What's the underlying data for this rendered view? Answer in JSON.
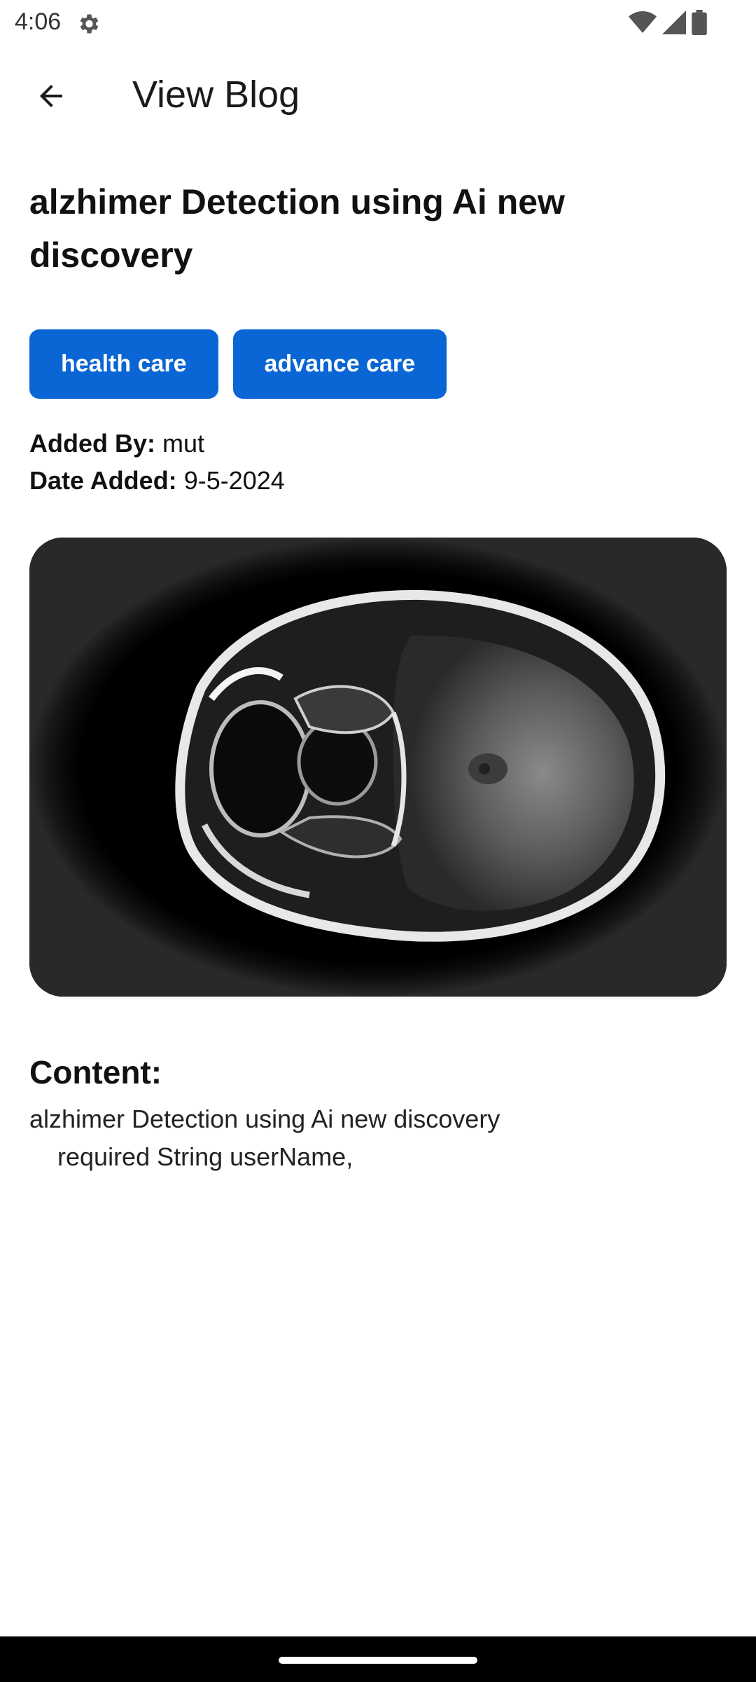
{
  "status_bar": {
    "time": "4:06",
    "icons": [
      "gear-icon",
      "wifi-icon",
      "signal-icon",
      "battery-icon"
    ]
  },
  "app_bar": {
    "title": "View Blog",
    "back_icon": "arrow-back-icon"
  },
  "blog": {
    "title": "alzhimer Detection using Ai new discovery",
    "tags": [
      "health care",
      "advance care"
    ],
    "added_by_label": "Added By:",
    "added_by_value": "mut",
    "date_label": "Date Added:",
    "date_value": "9-5-2024",
    "image_icon": "brain-mri-image",
    "content_heading": "Content:",
    "content_body": "alzhimer Detection using Ai new discovery\n    required String userName,"
  },
  "colors": {
    "accent": "#0a66d4",
    "background": "#ffffff",
    "nav_bar": "#000000"
  }
}
